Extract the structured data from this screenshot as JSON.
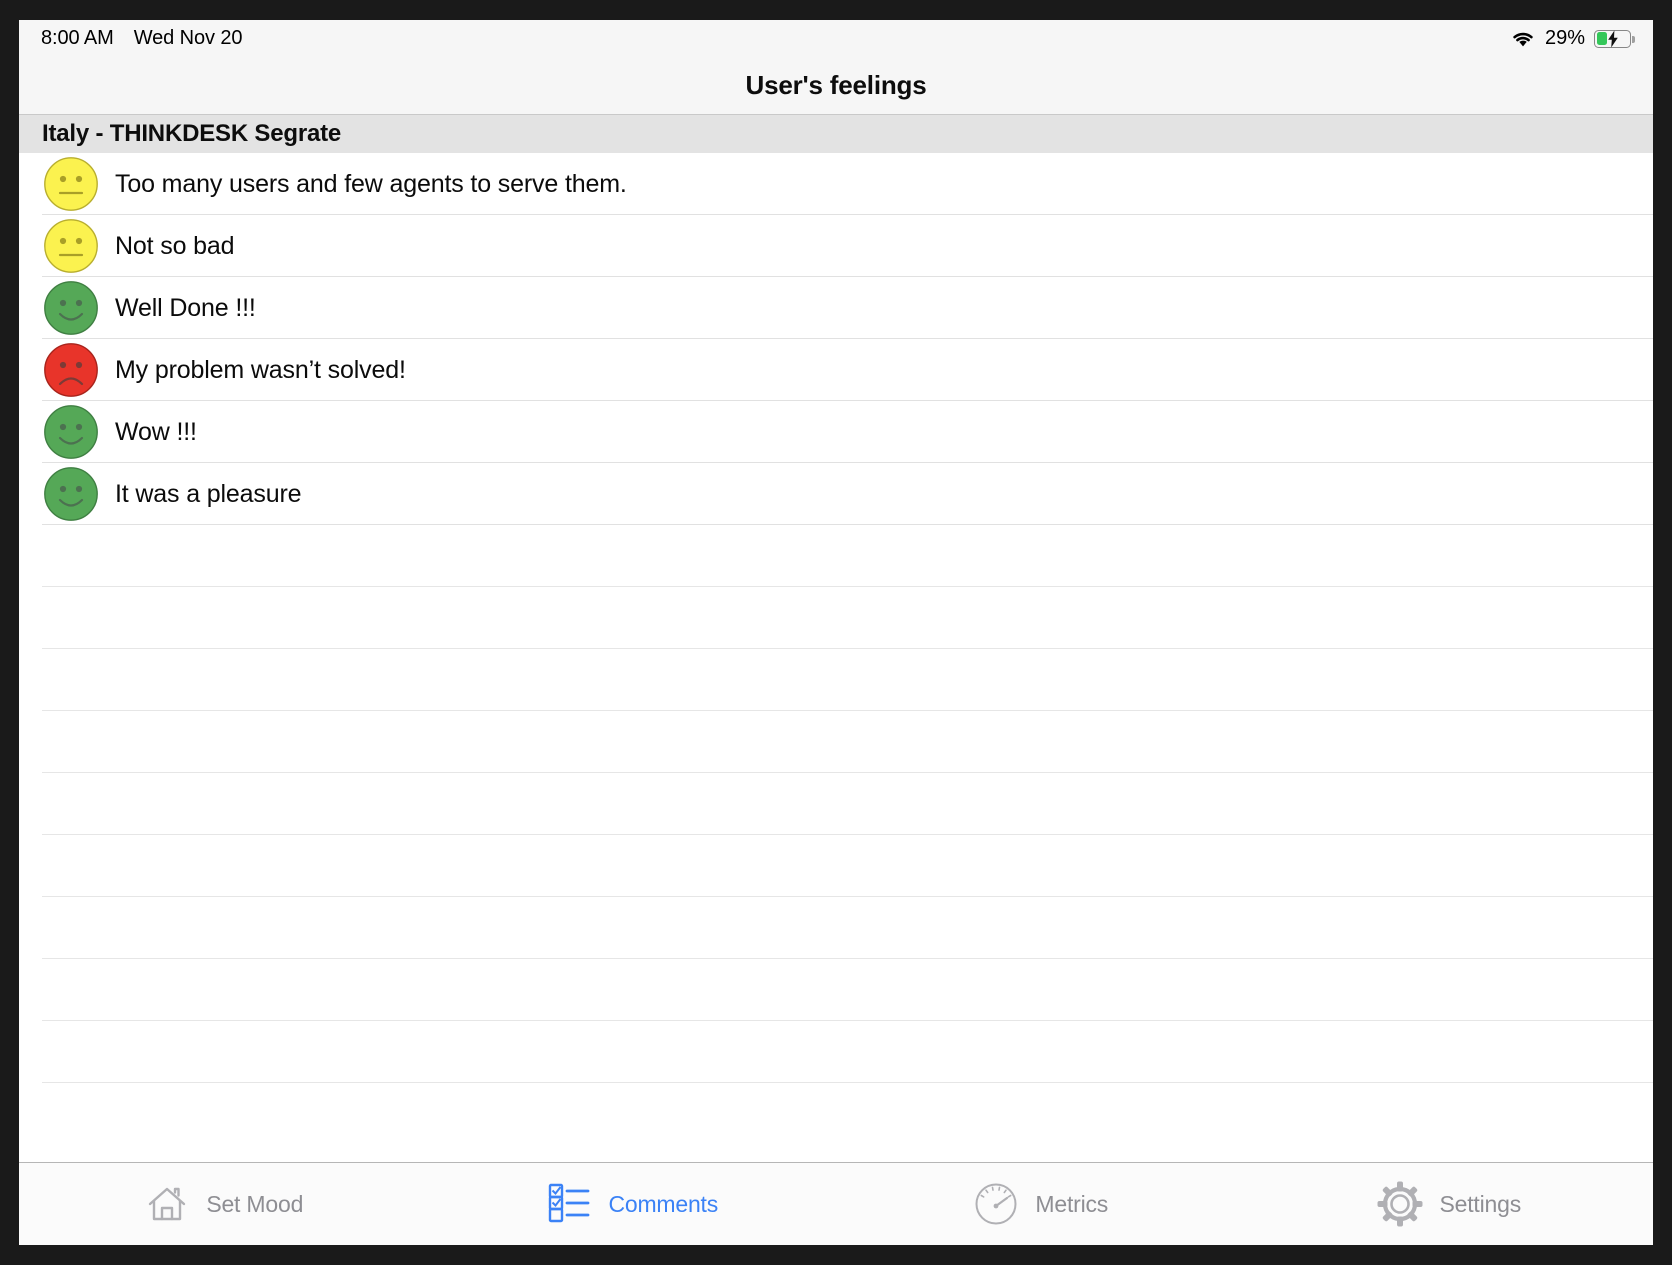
{
  "statusbar": {
    "time": "8:00 AM",
    "date": "Wed Nov 20",
    "battery_percent": "29%",
    "wifi_icon": "wifi-icon",
    "battery_icon": "battery-charging-icon",
    "battery_level": 29,
    "battery_charging": true,
    "battery_color": "#34c759"
  },
  "navbar": {
    "title": "User's feelings"
  },
  "section": {
    "header": "Italy - THINKDESK Segrate"
  },
  "list": {
    "rows": [
      {
        "mood": "neutral",
        "color": "#fbf24f",
        "text": "Too many users and few agents to serve them."
      },
      {
        "mood": "neutral",
        "color": "#fbf24f",
        "text": "Not so bad"
      },
      {
        "mood": "happy",
        "color": "#55a857",
        "text": "Well Done !!!"
      },
      {
        "mood": "sad",
        "color": "#e8342a",
        "text": "My problem wasn’t solved!"
      },
      {
        "mood": "happy",
        "color": "#55a857",
        "text": "Wow !!!"
      },
      {
        "mood": "happy",
        "color": "#55a857",
        "text": "It was a pleasure"
      }
    ],
    "empty_row_count": 9
  },
  "tabbar": {
    "active_index": 1,
    "active_color": "#3b82f6",
    "inactive_color": "#8e8e93",
    "tabs": [
      {
        "label": "Set Mood",
        "icon": "home-icon"
      },
      {
        "label": "Comments",
        "icon": "checklist-icon"
      },
      {
        "label": "Metrics",
        "icon": "gauge-icon"
      },
      {
        "label": "Settings",
        "icon": "gear-icon"
      }
    ]
  }
}
